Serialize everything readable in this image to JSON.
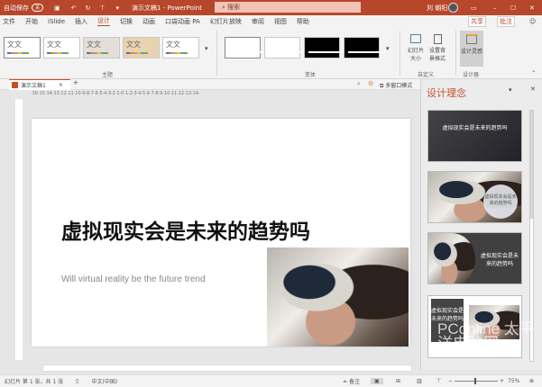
{
  "titlebar": {
    "autosave": "自动保存",
    "autosave_state": "关",
    "doc_title": "演示文稿1 - PowerPoint",
    "search_placeholder": "搜索",
    "user": "刘 朝阳"
  },
  "menu": {
    "tabs": [
      "文件",
      "开始",
      "iSlide",
      "插入",
      "设计",
      "切换",
      "动画",
      "口袋动画 PA",
      "幻灯片放映",
      "审阅",
      "视图",
      "帮助"
    ],
    "active": "设计",
    "share": "共享",
    "comment": "批注"
  },
  "ribbon": {
    "themes_label": "主题",
    "variants_label": "变体",
    "customize_label": "自定义",
    "designer_label": "设计器",
    "theme_text": "文文",
    "slide_size": "幻灯片大小",
    "format_bg": "设置背景格式",
    "design_ideas": "设计灵感"
  },
  "doctab": {
    "name": "演示文稿1",
    "multiwindow": "多窗口模式"
  },
  "ruler": "·16·15·14·13·12·11·10·9·8·7·6·5·4·3·2·1·0·1·2·3·4·5·6·7·8·9·10·11·12·13·14·",
  "slide": {
    "title": "虚拟现实会是未来的趋势吗",
    "subtitle": "Will virtual reality be the future trend"
  },
  "pane": {
    "title": "设计理念",
    "thumbs": [
      "虚拟现实会是未来的趋势吗",
      "虚拟现实会是未来的趋势吗",
      "虚拟现实会是未来的趋势吗",
      "虚拟现实会是未来的趋势吗"
    ]
  },
  "status": {
    "slide_info": "幻灯片 第 1 张，共 1 张",
    "language": "中文(中国)",
    "notes": "备注",
    "zoom": "75%"
  },
  "watermark": "PConline 太平洋电脑网"
}
